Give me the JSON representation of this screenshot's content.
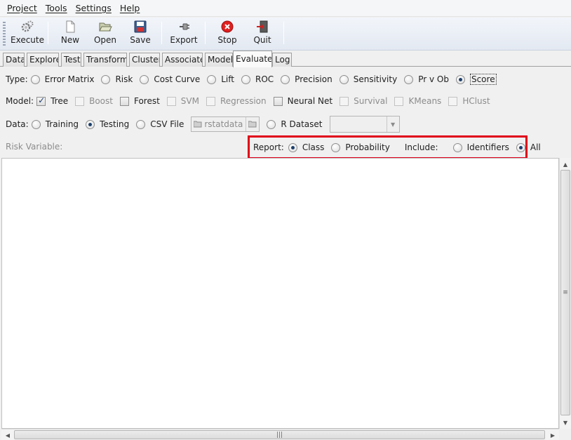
{
  "menu": {
    "items": [
      "Project",
      "Tools",
      "Settings",
      "Help"
    ]
  },
  "toolbar": {
    "execute": "Execute",
    "new": "New",
    "open": "Open",
    "save": "Save",
    "export": "Export",
    "stop": "Stop",
    "quit": "Quit"
  },
  "tabs": [
    "Data",
    "Explore",
    "Test",
    "Transform",
    "Cluster",
    "Associate",
    "Model",
    "Evaluate",
    "Log"
  ],
  "active_tab": "Evaluate",
  "type_row": {
    "label": "Type:",
    "options": [
      "Error Matrix",
      "Risk",
      "Cost Curve",
      "Lift",
      "ROC",
      "Precision",
      "Sensitivity",
      "Pr v Ob",
      "Score"
    ],
    "selected": "Score"
  },
  "model_row": {
    "label": "Model:",
    "options": [
      {
        "label": "Tree",
        "checked": true,
        "enabled": true
      },
      {
        "label": "Boost",
        "checked": false,
        "enabled": false
      },
      {
        "label": "Forest",
        "checked": false,
        "enabled": true
      },
      {
        "label": "SVM",
        "checked": false,
        "enabled": false
      },
      {
        "label": "Regression",
        "checked": false,
        "enabled": false
      },
      {
        "label": "Neural Net",
        "checked": false,
        "enabled": true
      },
      {
        "label": "Survival",
        "checked": false,
        "enabled": false
      },
      {
        "label": "KMeans",
        "checked": false,
        "enabled": false
      },
      {
        "label": "HClust",
        "checked": false,
        "enabled": false
      }
    ]
  },
  "data_row": {
    "label": "Data:",
    "training": "Training",
    "testing": "Testing",
    "csv_file": "CSV File",
    "file_value": "rstatdata",
    "r_dataset": "R Dataset",
    "selected": "Testing"
  },
  "risk_variable": "Risk Variable:",
  "report": {
    "label": "Report:",
    "class": "Class",
    "probability": "Probability",
    "selected": "Class",
    "include_label": "Include:",
    "identifiers": "Identifiers",
    "all": "All",
    "include_selected": "All"
  },
  "colors": {
    "highlight_box": "#e0001a",
    "stop_icon": "#e02020"
  }
}
